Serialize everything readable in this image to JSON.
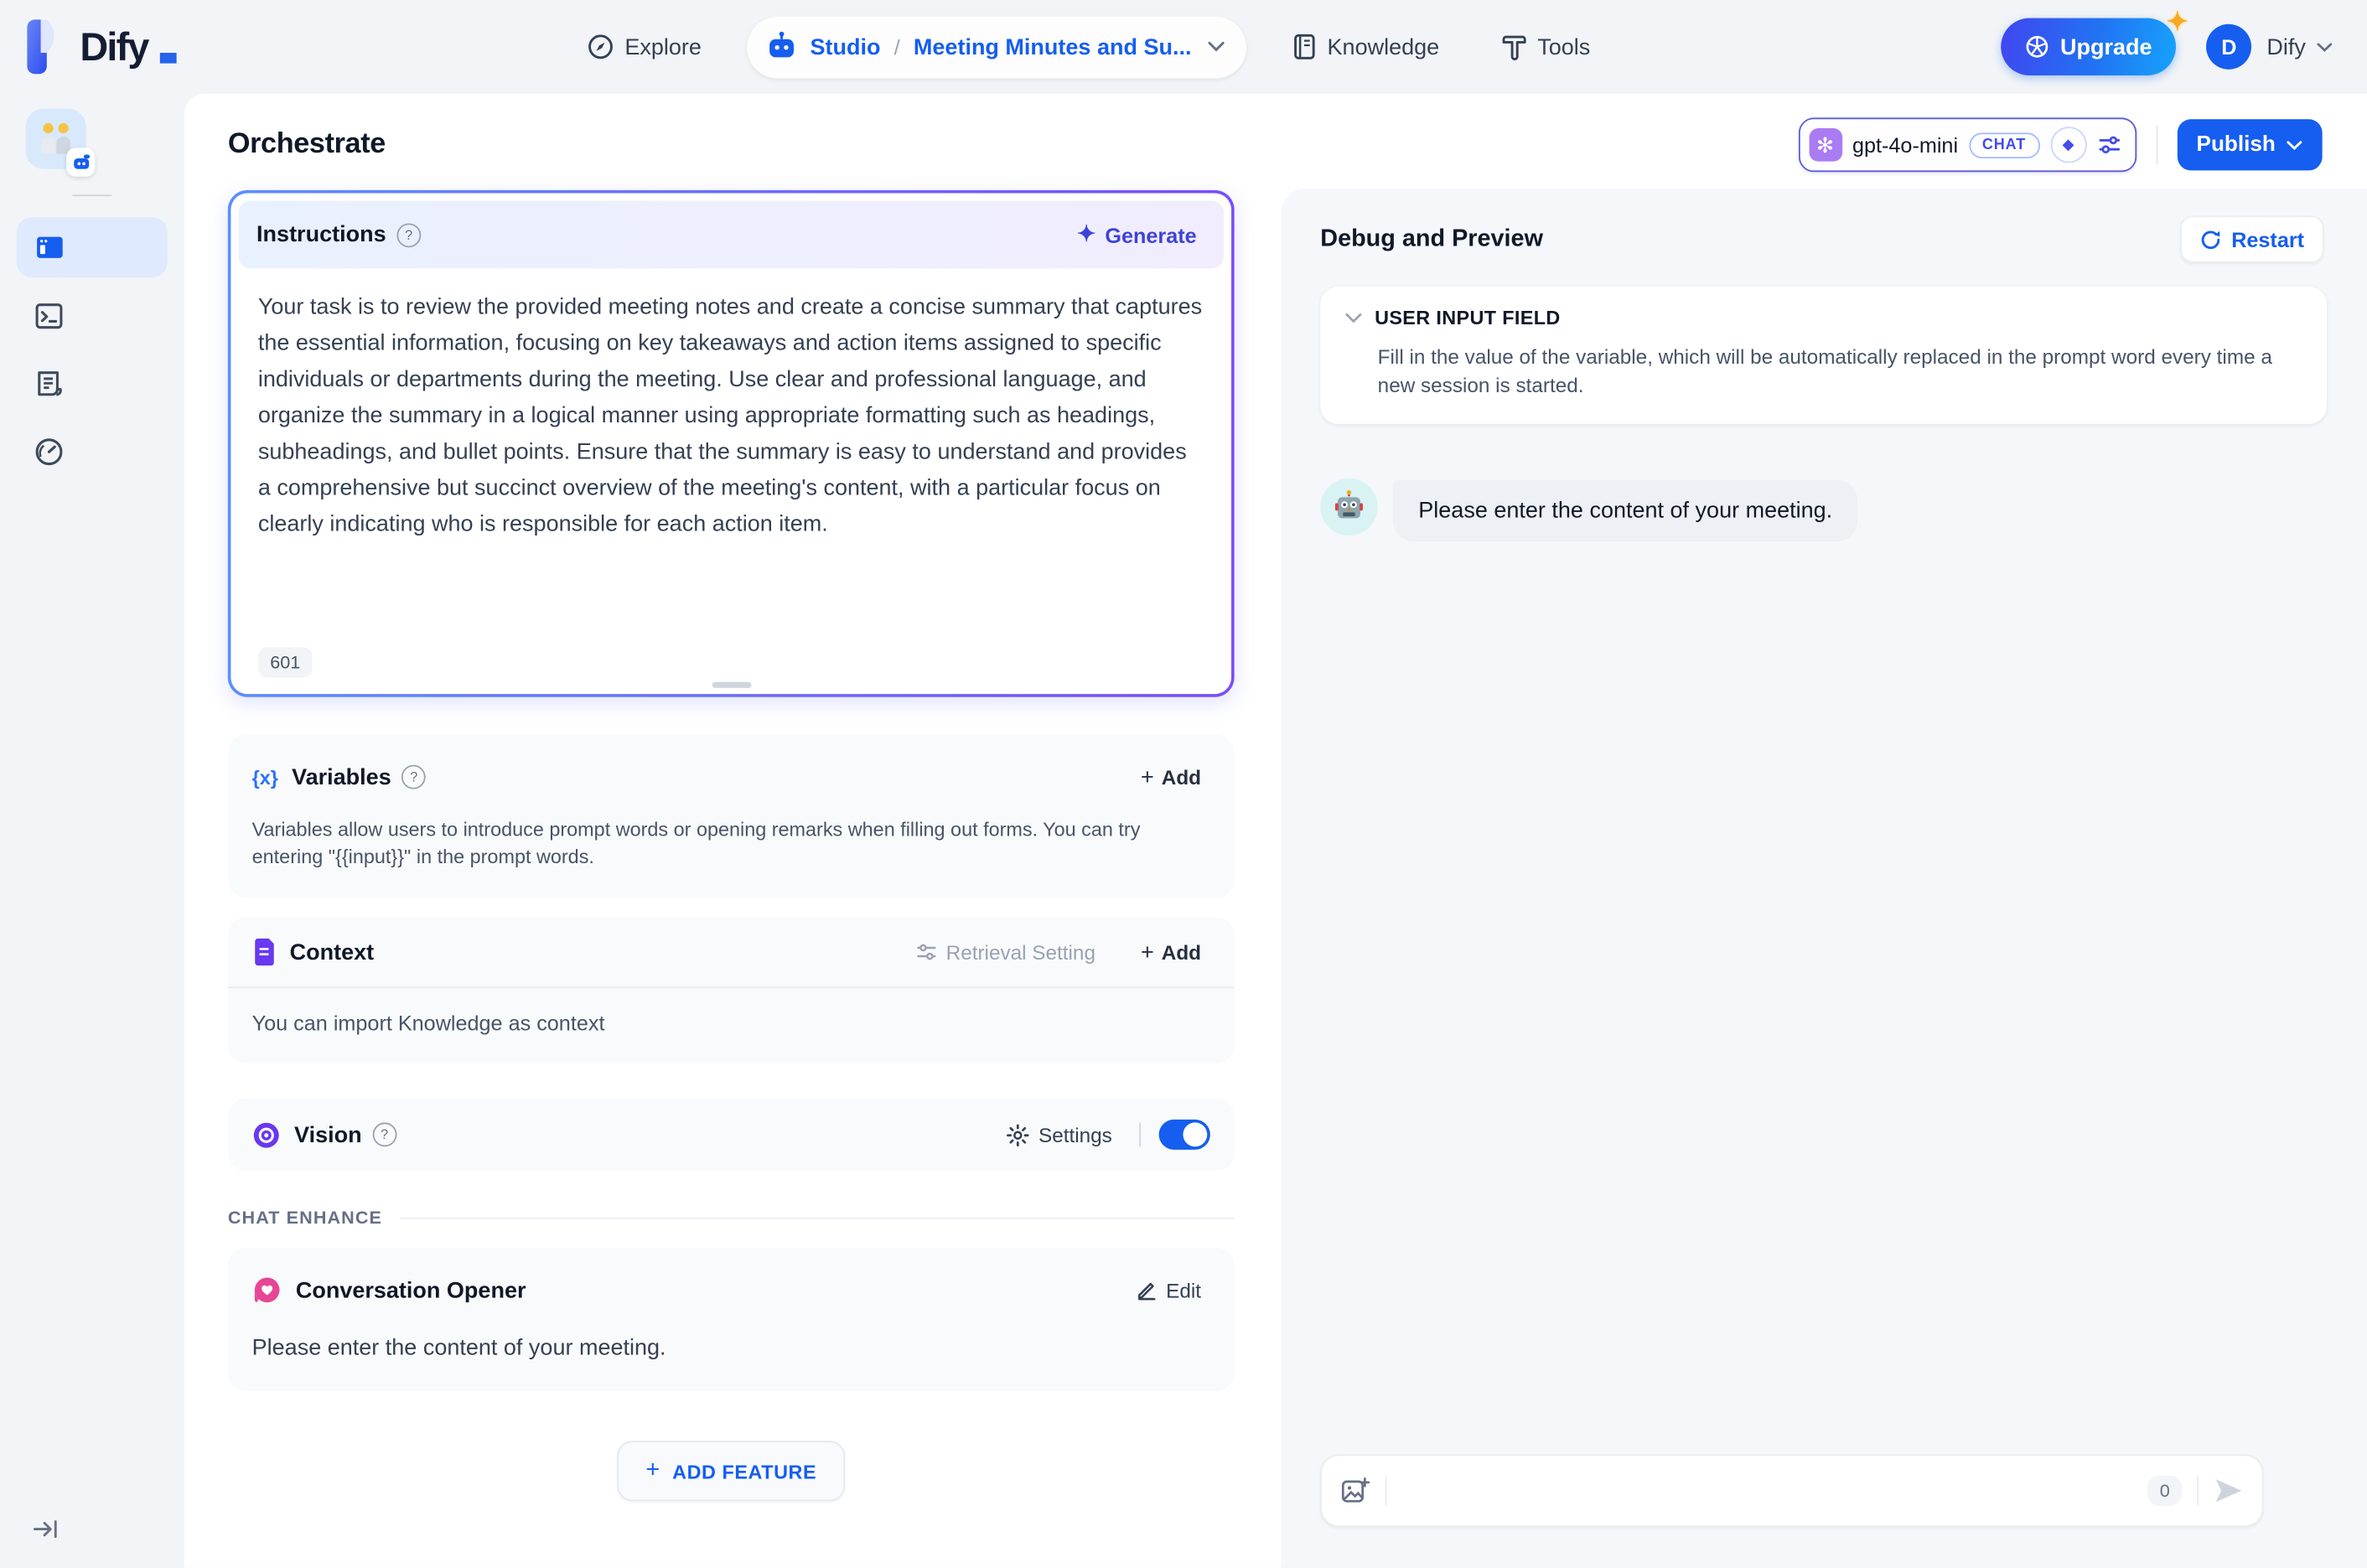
{
  "topnav": {
    "logo_text": "Dify",
    "explore_label": "Explore",
    "studio_label": "Studio",
    "breadcrumb_separator": "/",
    "app_name": "Meeting Minutes and Su...",
    "knowledge_label": "Knowledge",
    "tools_label": "Tools",
    "upgrade_label": "Upgrade",
    "avatar_initial": "D",
    "account_name": "Dify"
  },
  "sidebar": {
    "app_icon_emoji": "🧑‍🤝‍🧑",
    "items": [
      {
        "name": "orchestrate",
        "active": true
      },
      {
        "name": "api-access",
        "active": false
      },
      {
        "name": "logs-annotations",
        "active": false
      },
      {
        "name": "monitoring",
        "active": false
      }
    ]
  },
  "page": {
    "title": "Orchestrate"
  },
  "model_bar": {
    "model_name": "gpt-4o-mini",
    "model_type_badge": "CHAT",
    "publish_label": "Publish"
  },
  "instructions": {
    "title": "Instructions",
    "generate_label": "Generate",
    "body": "Your task is to review the provided meeting notes and create a concise summary that captures the essential information, focusing on key takeaways and action items assigned to specific individuals or departments during the meeting. Use clear and professional language, and organize the summary in a logical manner using appropriate formatting such as headings, subheadings, and bullet points. Ensure that the summary is easy to understand and provides a comprehensive but succinct overview of the meeting's content, with a particular focus on clearly indicating who is responsible for each action item.",
    "char_count": "601"
  },
  "variables": {
    "title": "Variables",
    "add_label": "Add",
    "description": "Variables allow users to introduce prompt words or opening remarks when filling out forms. You can try entering \"{{input}}\" in the prompt words."
  },
  "context": {
    "title": "Context",
    "retrieval_setting_label": "Retrieval Setting",
    "add_label": "Add",
    "description": "You can import Knowledge as context"
  },
  "vision": {
    "title": "Vision",
    "settings_label": "Settings",
    "enabled": true
  },
  "chat_enhance": {
    "section_label": "CHAT ENHANCE",
    "conversation_opener": {
      "title": "Conversation Opener",
      "edit_label": "Edit",
      "message": "Please enter the content of your meeting."
    }
  },
  "add_feature": {
    "label": "ADD FEATURE"
  },
  "debug_panel": {
    "title": "Debug and Preview",
    "restart_label": "Restart",
    "user_input_field": {
      "title": "USER INPUT FIELD",
      "description": "Fill in the value of the variable, which will be automatically replaced in the prompt word every time a new session is started."
    },
    "bot_avatar_emoji": "🤖",
    "bot_message": "Please enter the content of your meeting.",
    "chat_input": {
      "value": "",
      "char_count": "0"
    }
  },
  "icons": {
    "variables_icon_text": "{x}",
    "openai_logo_glyph": "✻",
    "diamond_glyph": "◆",
    "sparkle_glyph": "✦",
    "plus_glyph": "+",
    "help_glyph": "?"
  },
  "colors": {
    "accent_blue": "#155eef",
    "indigo": "#444ce7",
    "purple": "#6938ef",
    "pink": "#e74694",
    "page_bg": "#f2f4f7",
    "panel_bg": "#f5f7fa",
    "card_bg": "#f9fafb",
    "text_primary": "#101828",
    "text_secondary": "#475467"
  }
}
